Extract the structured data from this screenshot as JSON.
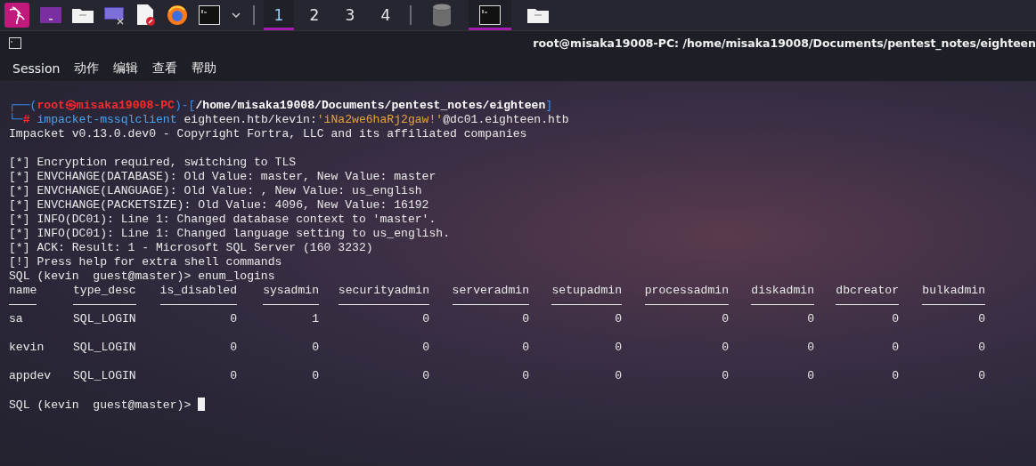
{
  "taskbar": {
    "launchers": [
      {
        "kind": "kali"
      },
      {
        "kind": "purple-window"
      },
      {
        "kind": "folder"
      },
      {
        "kind": "screen"
      },
      {
        "kind": "document"
      },
      {
        "kind": "firefox"
      },
      {
        "kind": "terminal"
      },
      {
        "kind": "chevron"
      }
    ],
    "workspaces": [
      {
        "label": "1",
        "selected": true
      },
      {
        "label": "2",
        "selected": false
      },
      {
        "label": "3",
        "selected": false
      },
      {
        "label": "4",
        "selected": false
      }
    ],
    "tasks": [
      {
        "kind": "database",
        "selected": false
      },
      {
        "kind": "terminal",
        "selected": true
      },
      {
        "kind": "folder",
        "selected": false
      }
    ]
  },
  "terminal": {
    "title": "root@misaka19008-PC: /home/misaka19008/Documents/pentest_notes/eighteen",
    "menu": [
      "Session",
      "动作",
      "编辑",
      "查看",
      "帮助"
    ],
    "prompt": {
      "open": "┌──(",
      "user": "root㉿misaka19008-PC",
      "mid": ")-[",
      "path": "/home/misaka19008/Documents/pentest_notes/eighteen",
      "close": "]",
      "corner": "└─",
      "hash": "#",
      "command": "impacket-mssqlclient",
      "arg": " eighteen.htb/kevin:",
      "password": "'iNa2we6haRj2gaw!'",
      "host": "@dc01.eighteen.htb"
    },
    "banner": "Impacket v0.13.0.dev0 - Copyright Fortra, LLC and its affiliated companies",
    "output": [
      "[*] Encryption required, switching to TLS",
      "[*] ENVCHANGE(DATABASE): Old Value: master, New Value: master",
      "[*] ENVCHANGE(LANGUAGE): Old Value: , New Value: us_english",
      "[*] ENVCHANGE(PACKETSIZE): Old Value: 4096, New Value: 16192",
      "[*] INFO(DC01): Line 1: Changed database context to 'master'.",
      "[*] INFO(DC01): Line 1: Changed language setting to us_english.",
      "[*] ACK: Result: 1 - Microsoft SQL Server (160 3232)",
      "[!] Press help for extra shell commands",
      "SQL (kevin  guest@master)> enum_logins"
    ],
    "table": {
      "columns": [
        {
          "label": "name",
          "kind": "text"
        },
        {
          "label": "type_desc",
          "kind": "text"
        },
        {
          "label": "is_disabled",
          "kind": "number"
        },
        {
          "label": "sysadmin",
          "kind": "number"
        },
        {
          "label": "securityadmin",
          "kind": "number"
        },
        {
          "label": "serveradmin",
          "kind": "number"
        },
        {
          "label": "setupadmin",
          "kind": "number"
        },
        {
          "label": "processadmin",
          "kind": "number"
        },
        {
          "label": "diskadmin",
          "kind": "number"
        },
        {
          "label": "dbcreator",
          "kind": "number"
        },
        {
          "label": "bulkadmin",
          "kind": "number"
        }
      ],
      "rows": [
        [
          "sa",
          "SQL_LOGIN",
          "0",
          "1",
          "0",
          "0",
          "0",
          "0",
          "0",
          "0",
          "0"
        ],
        [
          "kevin",
          "SQL_LOGIN",
          "0",
          "0",
          "0",
          "0",
          "0",
          "0",
          "0",
          "0",
          "0"
        ],
        [
          "appdev",
          "SQL_LOGIN",
          "0",
          "0",
          "0",
          "0",
          "0",
          "0",
          "0",
          "0",
          "0"
        ]
      ]
    },
    "input_prompt": "SQL (kevin  guest@master)> "
  }
}
